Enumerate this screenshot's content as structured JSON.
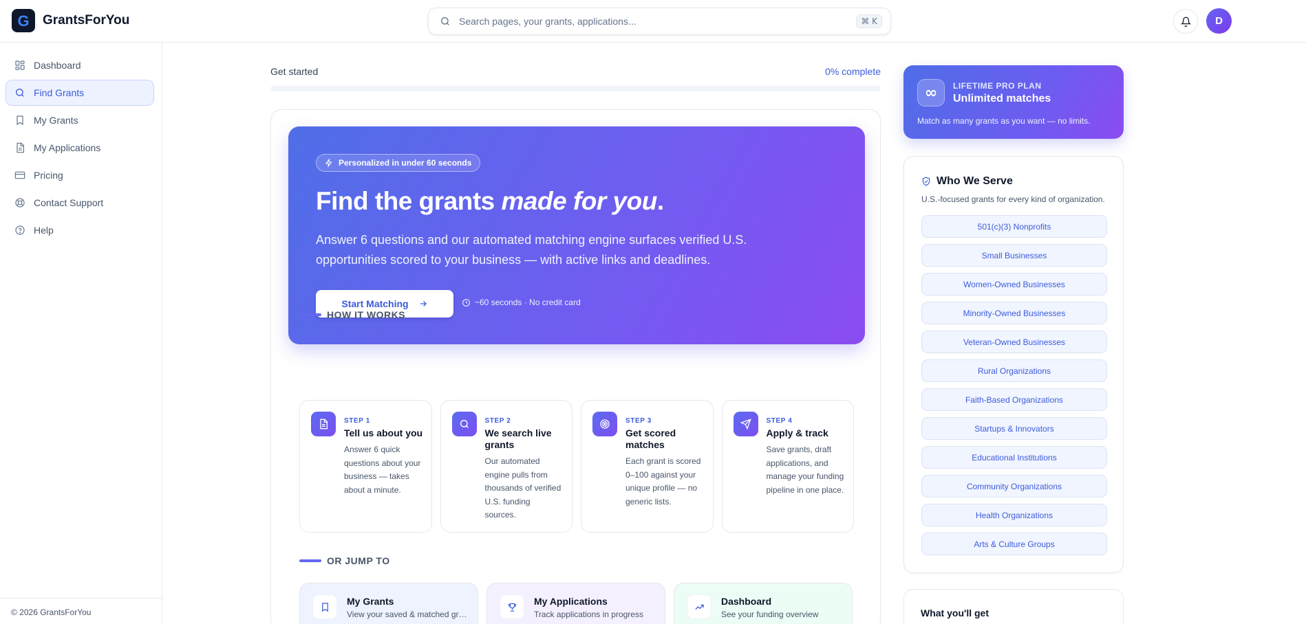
{
  "app": {
    "name": "GrantsForYou",
    "logo_letter": "G",
    "avatar_initial": "D"
  },
  "search": {
    "placeholder": "Search pages, your grants, applications...",
    "value": "",
    "shortcut": "⌘ K"
  },
  "sidebar": {
    "items": [
      {
        "label": "Dashboard",
        "icon": "grid-icon",
        "active": false
      },
      {
        "label": "Find Grants",
        "icon": "search-icon",
        "active": true
      },
      {
        "label": "My Grants",
        "icon": "bookmark-icon",
        "active": false
      },
      {
        "label": "My Applications",
        "icon": "document-icon",
        "active": false
      },
      {
        "label": "Pricing",
        "icon": "credit-card-icon",
        "active": false
      },
      {
        "label": "Contact Support",
        "icon": "lifebuoy-icon",
        "active": false
      },
      {
        "label": "Help",
        "icon": "help-circle-icon",
        "active": false
      }
    ],
    "footer": "© 2026 GrantsForYou"
  },
  "progress": {
    "label": "Get started",
    "percent_text": "0% complete",
    "percent": 0
  },
  "hero": {
    "badge": "Personalized in under 60 seconds",
    "title_plain": "Find the grants ",
    "title_emphasis": "made for you",
    "title_end": ".",
    "description": "Answer 6 questions and our automated matching engine surfaces verified U.S. opportunities scored to your business — with active links and deadlines.",
    "cta_label": "Start Matching",
    "meta": "~60 seconds · No credit card"
  },
  "how_it_works": {
    "heading": "HOW IT WORKS",
    "steps": [
      {
        "number": "STEP 1",
        "title": "Tell us about you",
        "description": "Answer 6 quick questions about your business — takes about a minute.",
        "icon": "document-icon"
      },
      {
        "number": "STEP 2",
        "title": "We search live grants",
        "description": "Our automated engine pulls from thousands of verified U.S. funding sources.",
        "icon": "search-icon"
      },
      {
        "number": "STEP 3",
        "title": "Get scored matches",
        "description": "Each grant is scored 0–100 against your unique profile — no generic lists.",
        "icon": "target-icon"
      },
      {
        "number": "STEP 4",
        "title": "Apply & track",
        "description": "Save grants, draft applications, and manage your funding pipeline in one place.",
        "icon": "send-icon"
      }
    ]
  },
  "jump_to": {
    "heading": "OR JUMP TO",
    "items": [
      {
        "title": "My Grants",
        "description": "View your saved & matched grants",
        "icon": "bookmark-icon"
      },
      {
        "title": "My Applications",
        "description": "Track applications in progress",
        "icon": "trophy-icon"
      },
      {
        "title": "Dashboard",
        "description": "See your funding overview",
        "icon": "trending-up-icon"
      }
    ]
  },
  "plan": {
    "kicker": "LIFETIME PRO PLAN",
    "title": "Unlimited matches",
    "description": "Match as many grants as you want — no limits.",
    "icon": "∞"
  },
  "who_we_serve": {
    "title": "Who We Serve",
    "subtitle": "U.S.-focused grants for every kind of organization.",
    "items": [
      "501(c)(3) Nonprofits",
      "Small Businesses",
      "Women-Owned Businesses",
      "Minority-Owned Businesses",
      "Veteran-Owned Businesses",
      "Rural Organizations",
      "Faith-Based Organizations",
      "Startups & Innovators",
      "Educational Institutions",
      "Community Organizations",
      "Health Organizations",
      "Arts & Culture Groups"
    ]
  },
  "what_you_get": {
    "title": "What you'll get"
  },
  "colors": {
    "accent": "#3b5bdb",
    "hero_start": "#4f6ee8",
    "hero_end": "#8b4cf0"
  }
}
